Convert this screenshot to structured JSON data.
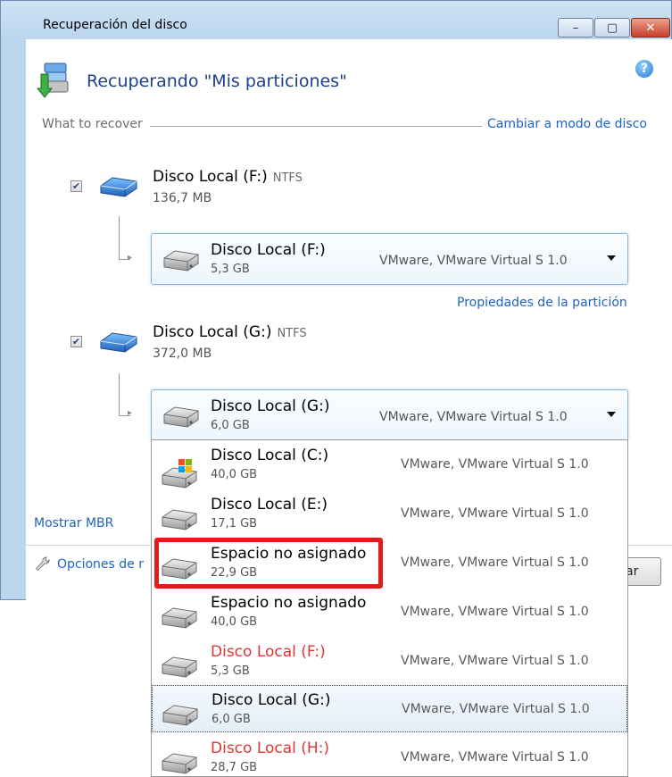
{
  "window": {
    "title": "Recuperación del disco",
    "controls": {
      "minimize": "–",
      "maximize": "▢",
      "close": "✕"
    }
  },
  "header": {
    "title": "Recuperando \"Mis particiones\"",
    "help_glyph": "?"
  },
  "section": {
    "label": "What to recover",
    "switch_link": "Cambiar a modo de disco"
  },
  "partitions": [
    {
      "checked": true,
      "name": "Disco Local (F:)",
      "fs": "NTFS",
      "size": "136,7 MB",
      "target": {
        "name": "Disco Local (F:)",
        "size": "5,3 GB",
        "device": "VMware, VMware Virtual S 1.0"
      }
    },
    {
      "checked": true,
      "name": "Disco Local (G:)",
      "fs": "NTFS",
      "size": "372,0 MB",
      "target": {
        "name": "Disco Local (G:)",
        "size": "6,0 GB",
        "device": "VMware, VMware Virtual S 1.0"
      }
    }
  ],
  "links": {
    "partition_props": "Propiedades de la partición",
    "show_mbr": "Mostrar MBR",
    "options": "Opciones de r"
  },
  "footer": {
    "button_partial": "ar"
  },
  "dropdown": {
    "items": [
      {
        "name": "Disco Local (C:)",
        "size": "40,0 GB",
        "device": "VMware, VMware Virtual S 1.0",
        "icon": "windows-drive-icon"
      },
      {
        "name": "Disco Local (E:)",
        "size": "17,1 GB",
        "device": "VMware, VMware Virtual S 1.0",
        "icon": "hard-drive-icon"
      },
      {
        "name": "Espacio no asignado",
        "size": "22,9 GB",
        "device": "VMware, VMware Virtual S 1.0",
        "icon": "hard-drive-icon",
        "annotated": true
      },
      {
        "name": "Espacio no asignado",
        "size": "40,0 GB",
        "device": "VMware, VMware Virtual S 1.0",
        "icon": "hard-drive-icon"
      },
      {
        "name": "Disco Local (F:)",
        "size": "5,3 GB",
        "device": "VMware, VMware Virtual S 1.0",
        "icon": "hard-drive-icon",
        "unavailable": true
      },
      {
        "name": "Disco Local (G:)",
        "size": "6,0 GB",
        "device": "VMware, VMware Virtual S 1.0",
        "icon": "hard-drive-icon",
        "selected": true
      },
      {
        "name": "Disco Local (H:)",
        "size": "28,7 GB",
        "device": "VMware, VMware Virtual S 1.0",
        "icon": "hard-drive-icon",
        "unavailable": true
      }
    ]
  },
  "colors": {
    "link": "#1c64c4",
    "heading": "#1c3f8e",
    "unavailable": "#e43333",
    "annotation": "#e21b1b"
  }
}
